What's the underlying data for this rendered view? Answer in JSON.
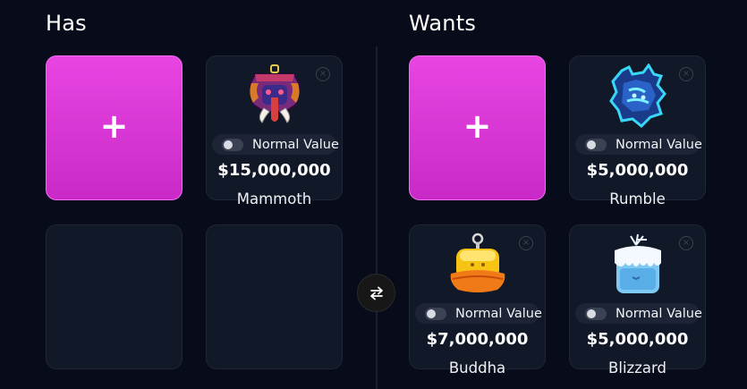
{
  "has": {
    "title": "Has",
    "add_label": "+",
    "items": [
      {
        "name": "Mammoth",
        "price": "$15,000,000",
        "toggle_label": "Normal Value",
        "remove_label": "×",
        "icon": "mammoth-fruit-icon"
      }
    ]
  },
  "wants": {
    "title": "Wants",
    "add_label": "+",
    "items": [
      {
        "name": "Rumble",
        "price": "$5,000,000",
        "toggle_label": "Normal Value",
        "remove_label": "×",
        "icon": "rumble-fruit-icon"
      },
      {
        "name": "Buddha",
        "price": "$7,000,000",
        "toggle_label": "Normal Value",
        "remove_label": "×",
        "icon": "buddha-fruit-icon"
      },
      {
        "name": "Blizzard",
        "price": "$5,000,000",
        "toggle_label": "Normal Value",
        "remove_label": "×",
        "icon": "blizzard-fruit-icon"
      }
    ]
  },
  "swap": {
    "icon": "swap-arrows-icon"
  },
  "colors": {
    "background": "#080c1a",
    "card": "#111827",
    "accent": "#e845e3"
  }
}
